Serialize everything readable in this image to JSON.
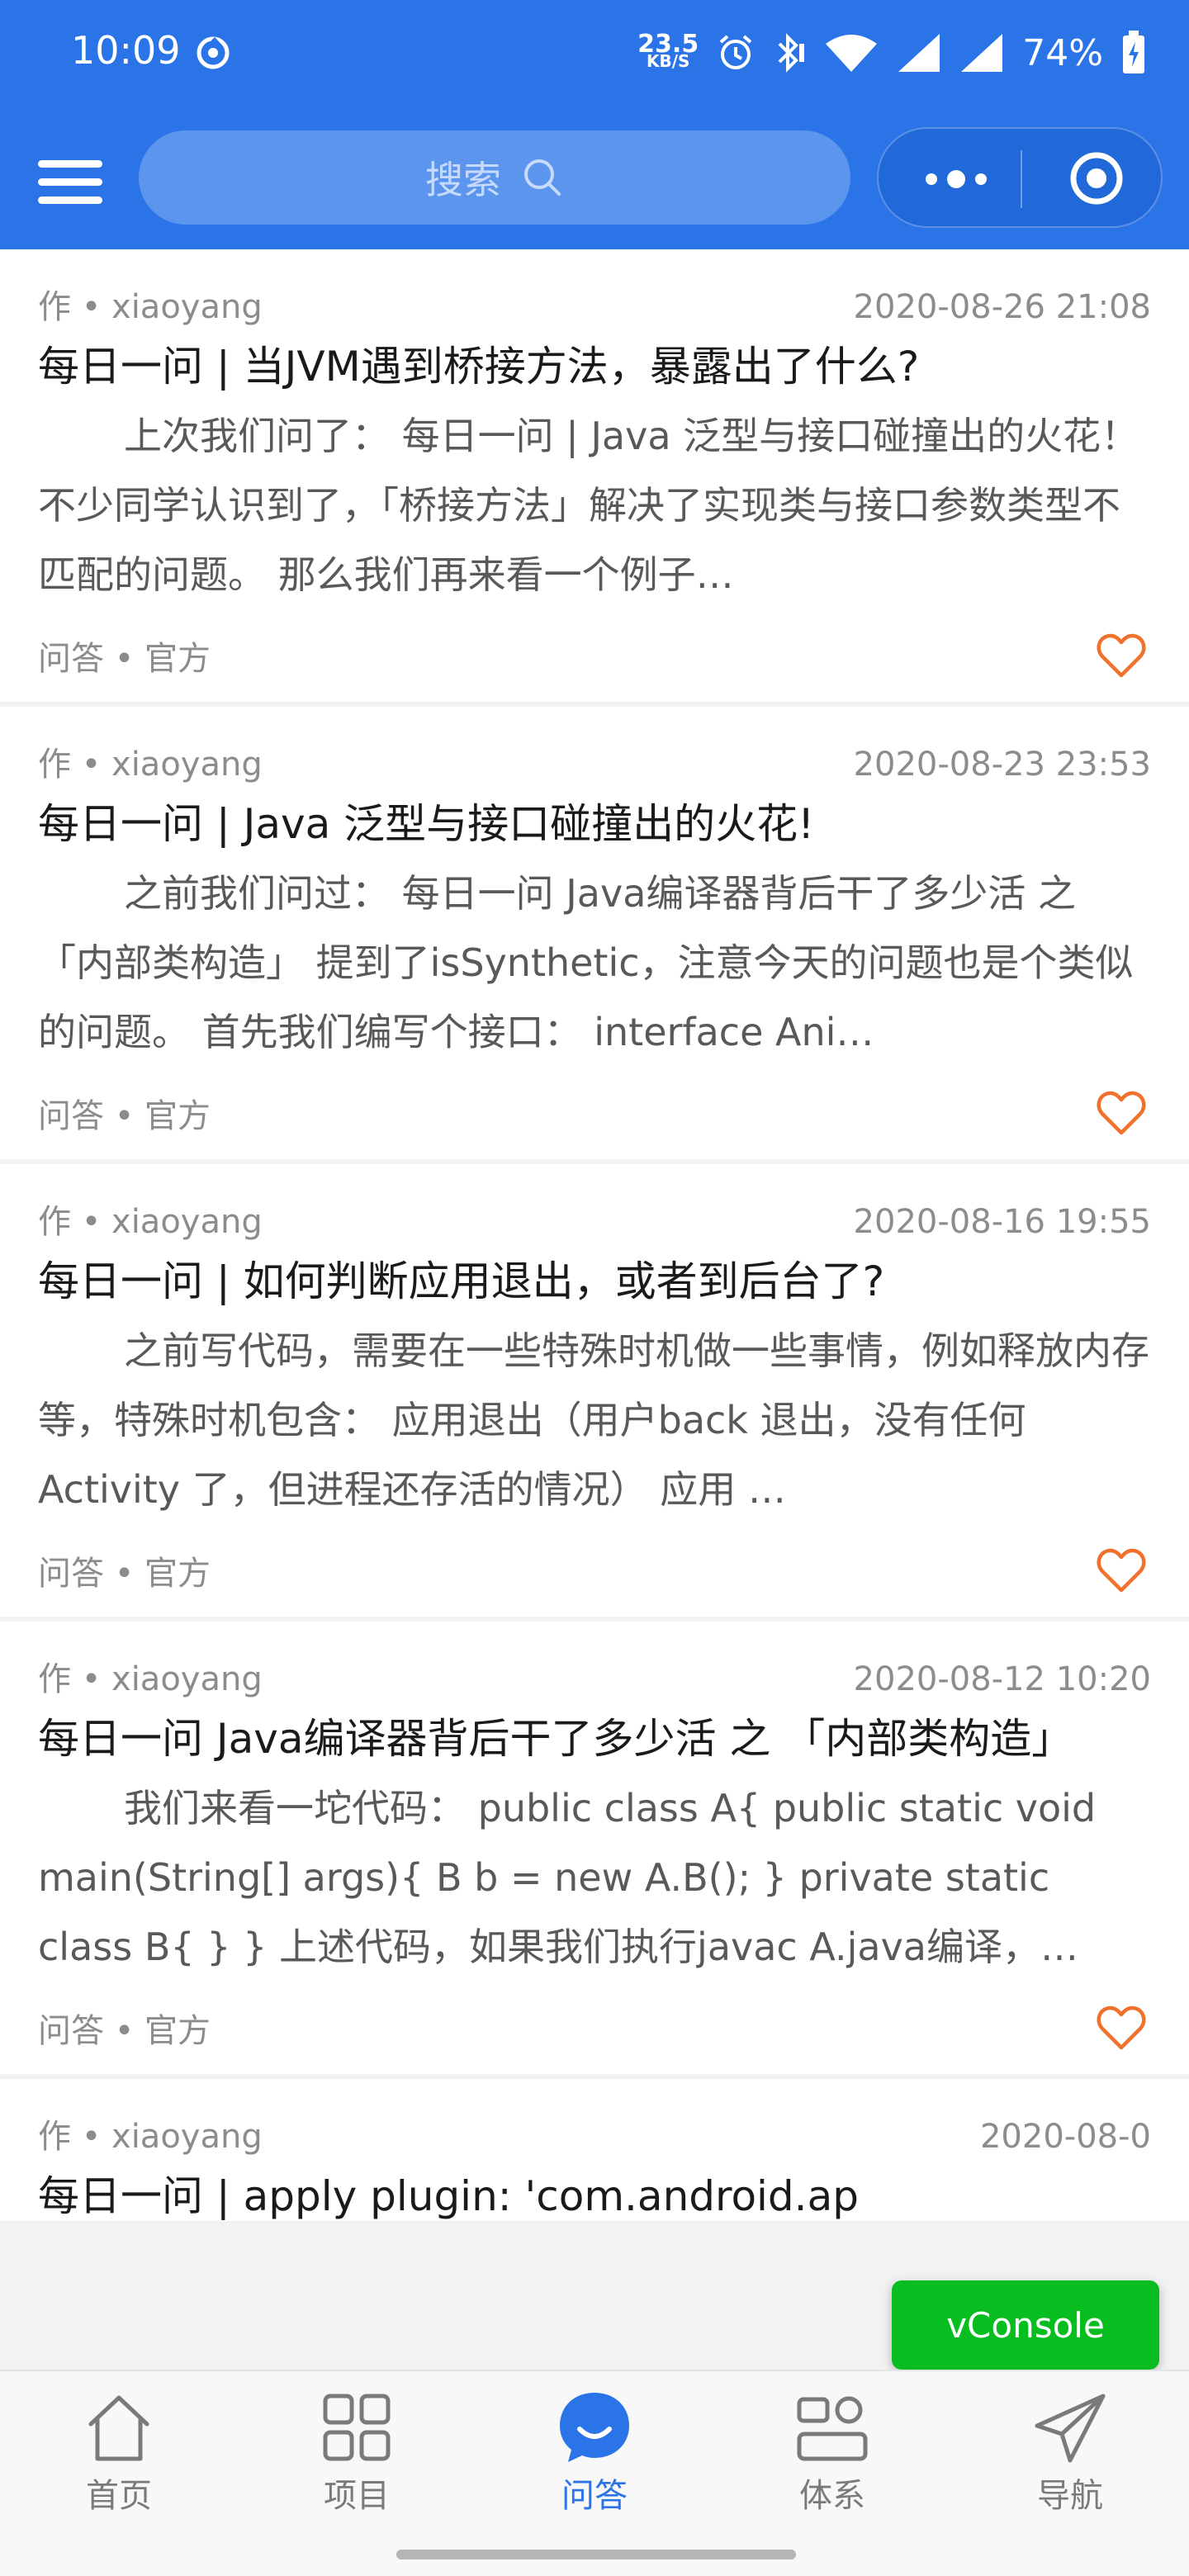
{
  "status_bar": {
    "time": "10:09",
    "net_speed_value": "23.5",
    "net_speed_unit": "KB/S",
    "battery": "74%"
  },
  "header": {
    "search_placeholder": "搜索"
  },
  "articles": [
    {
      "author": "作 • xiaoyang",
      "date": "2020-08-26 21:08",
      "title": "每日一问 | 当JVM遇到桥接方法，暴露出了什么?",
      "excerpt": "上次我们问了： 每日一问 | Java 泛型与接口碰撞出的火花！ 不少同学认识到了，「桥接方法」解决了实现类与接口参数类型不匹配的问题。 那么我们再来看一个例子…",
      "tags": "问答 • 官方"
    },
    {
      "author": "作 • xiaoyang",
      "date": "2020-08-23 23:53",
      "title": "每日一问 | Java 泛型与接口碰撞出的火花!",
      "excerpt": "之前我们问过： 每日一问 Java编译器背后干了多少活 之 「内部类构造」 提到了isSynthetic，注意今天的问题也是个类似的问题。 首先我们编写个接口： interface Ani…",
      "tags": "问答 • 官方"
    },
    {
      "author": "作 • xiaoyang",
      "date": "2020-08-16 19:55",
      "title": "每日一问 | 如何判断应用退出，或者到后台了?",
      "excerpt": "之前写代码，需要在一些特殊时机做一些事情，例如释放内存等，特殊时机包含： 应用退出（用户back 退出，没有任何 Activity 了，但进程还存活的情况） 应用 …",
      "tags": "问答 • 官方"
    },
    {
      "author": "作 • xiaoyang",
      "date": "2020-08-12 10:20",
      "title": "每日一问 Java编译器背后干了多少活 之 「内部类构造」",
      "excerpt": "我们来看一坨代码： public class A{ public static void main(String[] args){ B b = new A.B(); } private static class B{ } } 上述代码，如果我们执行javac A.java编译，…",
      "tags": "问答 • 官方"
    },
    {
      "author": "作 • xiaoyang",
      "date": "2020-08-0",
      "title": "每日一问 | apply plugin: 'com.android.ap",
      "excerpt": "",
      "tags": ""
    }
  ],
  "vconsole": "vConsole",
  "tabs": [
    {
      "label": "首页",
      "icon": "home-icon"
    },
    {
      "label": "项目",
      "icon": "grid-icon"
    },
    {
      "label": "问答",
      "icon": "chat-bubble-icon",
      "active": true
    },
    {
      "label": "体系",
      "icon": "system-icon"
    },
    {
      "label": "导航",
      "icon": "paper-plane-icon"
    }
  ],
  "colors": {
    "primary": "#2b74e8",
    "heart": "#f0712c",
    "vconsole": "#08bd20"
  }
}
